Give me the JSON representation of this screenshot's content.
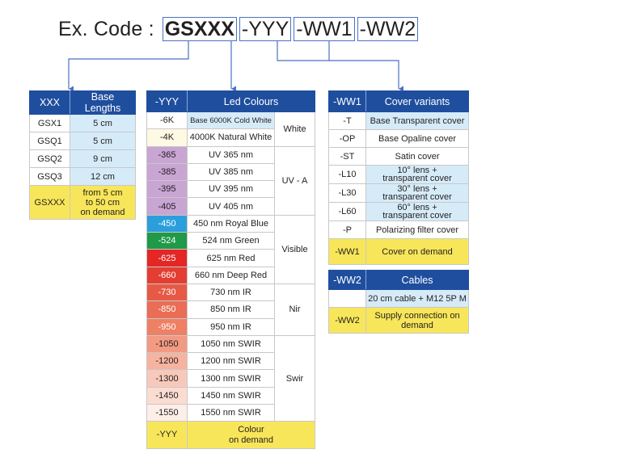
{
  "code_example": {
    "label": "Ex. Code :",
    "segments": [
      "GSXXX",
      "-YYY",
      "-WW1",
      "-WW2"
    ]
  },
  "colors": {
    "header_blue": "#1f4e9e",
    "connector_blue": "#4a72c4",
    "light_blue": "#d6ebf8",
    "yellow": "#f8e65a",
    "cream": "#fdf9e3"
  },
  "xxx_table": {
    "headers": [
      "XXX",
      "Base Lengths"
    ],
    "rows": [
      {
        "code": "GSX1",
        "value": "5 cm"
      },
      {
        "code": "GSQ1",
        "value": "5 cm"
      },
      {
        "code": "GSQ2",
        "value": "9 cm"
      },
      {
        "code": "GSQ3",
        "value": "12 cm"
      }
    ],
    "custom": {
      "code": "GSXXX",
      "value": "from 5 cm\nto 50 cm\non demand"
    }
  },
  "yyy_table": {
    "headers": [
      "-YYY",
      "Led Colours"
    ],
    "rows": [
      {
        "code": "-6K",
        "value": "Base 6000K Cold White",
        "swatch": "#ffffff",
        "value_bg": "#d6ebf8",
        "text": "#231f20"
      },
      {
        "code": "-4K",
        "value": "4000K Natural White",
        "swatch": "#fdf9e3",
        "value_bg": "#ffffff",
        "text": "#231f20"
      },
      {
        "code": "-365",
        "value": "UV 365 nm",
        "swatch": "#c9a5d3",
        "value_bg": "#ffffff",
        "text": "#231f20"
      },
      {
        "code": "-385",
        "value": "UV 385 nm",
        "swatch": "#c9a5d3",
        "value_bg": "#ffffff",
        "text": "#231f20"
      },
      {
        "code": "-395",
        "value": "UV 395 nm",
        "swatch": "#c9a5d3",
        "value_bg": "#ffffff",
        "text": "#231f20"
      },
      {
        "code": "-405",
        "value": "UV 405 nm",
        "swatch": "#c9a5d3",
        "value_bg": "#ffffff",
        "text": "#231f20"
      },
      {
        "code": "-450",
        "value": "450 nm Royal Blue",
        "swatch": "#2b9fdc",
        "value_bg": "#ffffff",
        "text": "#ffffff"
      },
      {
        "code": "-524",
        "value": "524 nm Green",
        "swatch": "#1e9a48",
        "value_bg": "#ffffff",
        "text": "#ffffff"
      },
      {
        "code": "-625",
        "value": "625 nm Red",
        "swatch": "#e42625",
        "value_bg": "#ffffff",
        "text": "#ffffff"
      },
      {
        "code": "-660",
        "value": "660 nm Deep Red",
        "swatch": "#e43e33",
        "value_bg": "#ffffff",
        "text": "#ffffff"
      },
      {
        "code": "-730",
        "value": "730 nm IR",
        "swatch": "#e65a45",
        "value_bg": "#ffffff",
        "text": "#ffffff"
      },
      {
        "code": "-850",
        "value": "850 nm IR",
        "swatch": "#ea6d55",
        "value_bg": "#ffffff",
        "text": "#ffffff"
      },
      {
        "code": "-950",
        "value": "950 nm IR",
        "swatch": "#ee8066",
        "value_bg": "#ffffff",
        "text": "#ffffff"
      },
      {
        "code": "-1050",
        "value": "1050 nm SWIR",
        "swatch": "#f29a83",
        "value_bg": "#ffffff",
        "text": "#231f20"
      },
      {
        "code": "-1200",
        "value": "1200 nm SWIR",
        "swatch": "#f5b3a0",
        "value_bg": "#ffffff",
        "text": "#231f20"
      },
      {
        "code": "-1300",
        "value": "1300 nm SWIR",
        "swatch": "#f8c9ba",
        "value_bg": "#ffffff",
        "text": "#231f20"
      },
      {
        "code": "-1450",
        "value": "1450 nm SWIR",
        "swatch": "#fbdcd1",
        "value_bg": "#ffffff",
        "text": "#231f20"
      },
      {
        "code": "-1550",
        "value": "1550 nm SWIR",
        "swatch": "#fdeee8",
        "value_bg": "#ffffff",
        "text": "#231f20"
      }
    ],
    "groups": [
      {
        "label": "White",
        "span": 2
      },
      {
        "label": "UV - A",
        "span": 4
      },
      {
        "label": "Visible",
        "span": 4
      },
      {
        "label": "Nir",
        "span": 3
      },
      {
        "label": "Swir",
        "span": 5
      }
    ],
    "custom": {
      "code": "-YYY",
      "value": "Colour\non demand"
    }
  },
  "ww1_table": {
    "headers": [
      "-WW1",
      "Cover variants"
    ],
    "rows": [
      {
        "code": "-T",
        "value": "Base Transparent cover",
        "blue": true,
        "two_line": false
      },
      {
        "code": "-OP",
        "value": "Base Opaline cover",
        "blue": false,
        "two_line": false
      },
      {
        "code": "-ST",
        "value": "Satin cover",
        "blue": false,
        "two_line": false
      },
      {
        "code": "-L10",
        "value": "10° lens + transparent cover",
        "blue": true,
        "two_line": true
      },
      {
        "code": "-L30",
        "value": "30° lens + transparent cover",
        "blue": true,
        "two_line": true
      },
      {
        "code": "-L60",
        "value": "60° lens + transparent cover",
        "blue": true,
        "two_line": true
      },
      {
        "code": "-P",
        "value": "Polarizing filter cover",
        "blue": false,
        "two_line": false
      }
    ],
    "custom": {
      "code": "-WW1",
      "value": "Cover on demand"
    }
  },
  "ww2_table": {
    "headers": [
      "-WW2",
      "Cables"
    ],
    "rows": [
      {
        "code": "",
        "value": "20 cm cable + M12 5P M"
      }
    ],
    "custom": {
      "code": "-WW2",
      "value": "Supply connection on\ndemand"
    }
  }
}
